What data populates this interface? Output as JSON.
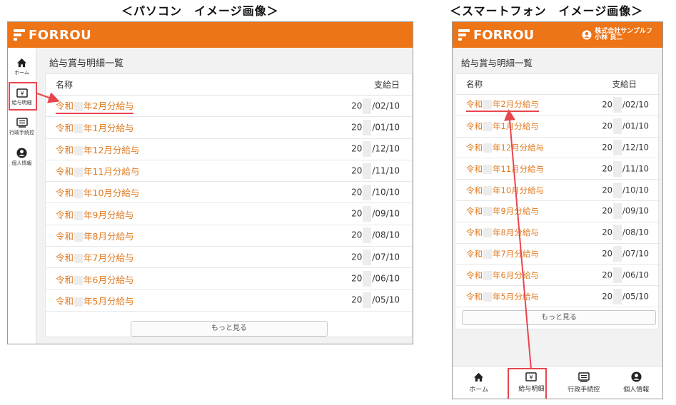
{
  "captions": {
    "pc": "＜パソコン　イメージ画像＞",
    "smartphone": "＜スマートフォン　イメージ画像＞"
  },
  "app": {
    "logo": "FORROU",
    "user_company": "株式会社サンプルフ",
    "user_name": "小林 良二",
    "brand_color": "#ed7417",
    "highlight_color": "#e8464e"
  },
  "pc_sidebar": [
    {
      "icon": "home-icon",
      "label": "ホーム"
    },
    {
      "icon": "yen-icon",
      "label": "給与明細",
      "active": true
    },
    {
      "icon": "document-icon",
      "label": "行政手続控"
    },
    {
      "icon": "user-icon",
      "label": "個人情報"
    }
  ],
  "bottom_nav": [
    {
      "icon": "home-icon",
      "label": "ホーム"
    },
    {
      "icon": "yen-icon",
      "label": "給与明細",
      "active": true
    },
    {
      "icon": "document-icon",
      "label": "行政手続控"
    },
    {
      "icon": "user-icon",
      "label": "個人情報"
    }
  ],
  "page": {
    "title": "給与賞与明細一覧",
    "col_name": "名称",
    "col_date": "支給日",
    "more_button": "もっと見る"
  },
  "rows": [
    {
      "era": "令和",
      "name": "年2月分給与",
      "year": "20",
      "date": "/02/10"
    },
    {
      "era": "令和",
      "name": "年1月分給与",
      "year": "20",
      "date": "/01/10"
    },
    {
      "era": "令和",
      "name": "年12月分給与",
      "year": "20",
      "date": "/12/10"
    },
    {
      "era": "令和",
      "name": "年11月分給与",
      "year": "20",
      "date": "/11/10"
    },
    {
      "era": "令和",
      "name": "年10月分給与",
      "year": "20",
      "date": "/10/10"
    },
    {
      "era": "令和",
      "name": "年9月分給与",
      "year": "20",
      "date": "/09/10"
    },
    {
      "era": "令和",
      "name": "年8月分給与",
      "year": "20",
      "date": "/08/10"
    },
    {
      "era": "令和",
      "name": "年7月分給与",
      "year": "20",
      "date": "/07/10"
    },
    {
      "era": "令和",
      "name": "年6月分給与",
      "year": "20",
      "date": "/06/10"
    },
    {
      "era": "令和",
      "name": "年5月分給与",
      "year": "20",
      "date": "/05/10"
    }
  ]
}
